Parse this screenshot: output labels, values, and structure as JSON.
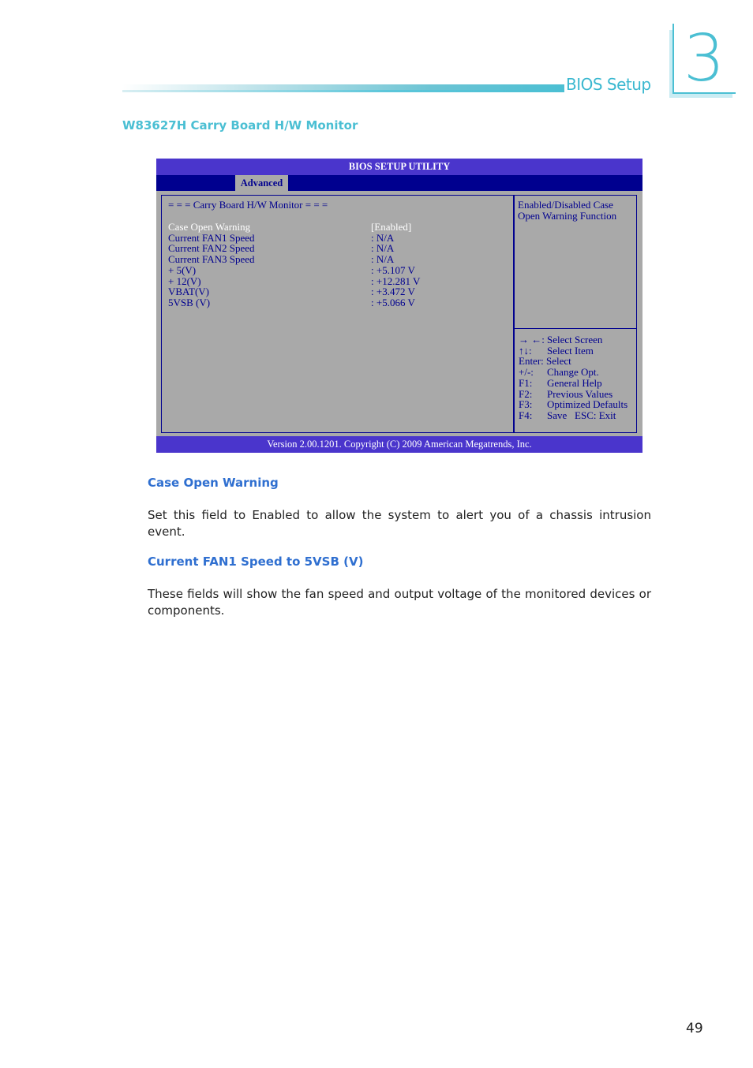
{
  "header": {
    "section_label": "BIOS Setup",
    "chapter_number": "3"
  },
  "section_title": "W83627H Carry Board H/W Monitor",
  "bios": {
    "title": "BIOS SETUP UTILITY",
    "tabs": [
      {
        "label": "Advanced",
        "active": true
      }
    ],
    "screen_heading": "= = = Carry Board H/W Monitor = = =",
    "items": [
      {
        "label": "Case Open Warning",
        "value": "[Enabled]",
        "selected": true
      },
      {
        "label": "Current FAN1 Speed",
        "value": ": N/A"
      },
      {
        "label": "Current FAN2 Speed",
        "value": ": N/A"
      },
      {
        "label": "Current FAN3 Speed",
        "value": ": N/A"
      },
      {
        "label": "+ 5(V)",
        "value": ": +5.107 V"
      },
      {
        "label": "+ 12(V)",
        "value": ": +12.281 V"
      },
      {
        "label": "VBAT(V)",
        "value": ": +3.472 V"
      },
      {
        "label": "5VSB (V)",
        "value": ": +5.066 V"
      }
    ],
    "help_text": [
      "Enabled/Disabled Case",
      "Open Warning Function"
    ],
    "key_help": [
      {
        "key": "→ ←:",
        "action": "Select Screen"
      },
      {
        "key": "↑↓:",
        "action": "Select Item"
      },
      {
        "key": "Enter:",
        "action": "Select"
      },
      {
        "key": "+/-:",
        "action": "Change Opt."
      },
      {
        "key": "F1:",
        "action": "General Help"
      },
      {
        "key": "F2:",
        "action": "Previous Values"
      },
      {
        "key": "F3:",
        "action": "Optimized Defaults"
      },
      {
        "key": "F4:",
        "action": "Save   ESC: Exit"
      }
    ],
    "footer": "Version 2.00.1201. Copyright (C) 2009 American Megatrends, Inc."
  },
  "body": {
    "subsections": [
      {
        "heading": "Case Open Warning",
        "text": "Set this field to Enabled to allow the system to alert you of a chassis intrusion event."
      },
      {
        "heading": "Current FAN1 Speed to 5VSB (V)",
        "text": "These fields will show the fan speed and output voltage of the monitored devices or components."
      }
    ]
  },
  "page_number": "49"
}
